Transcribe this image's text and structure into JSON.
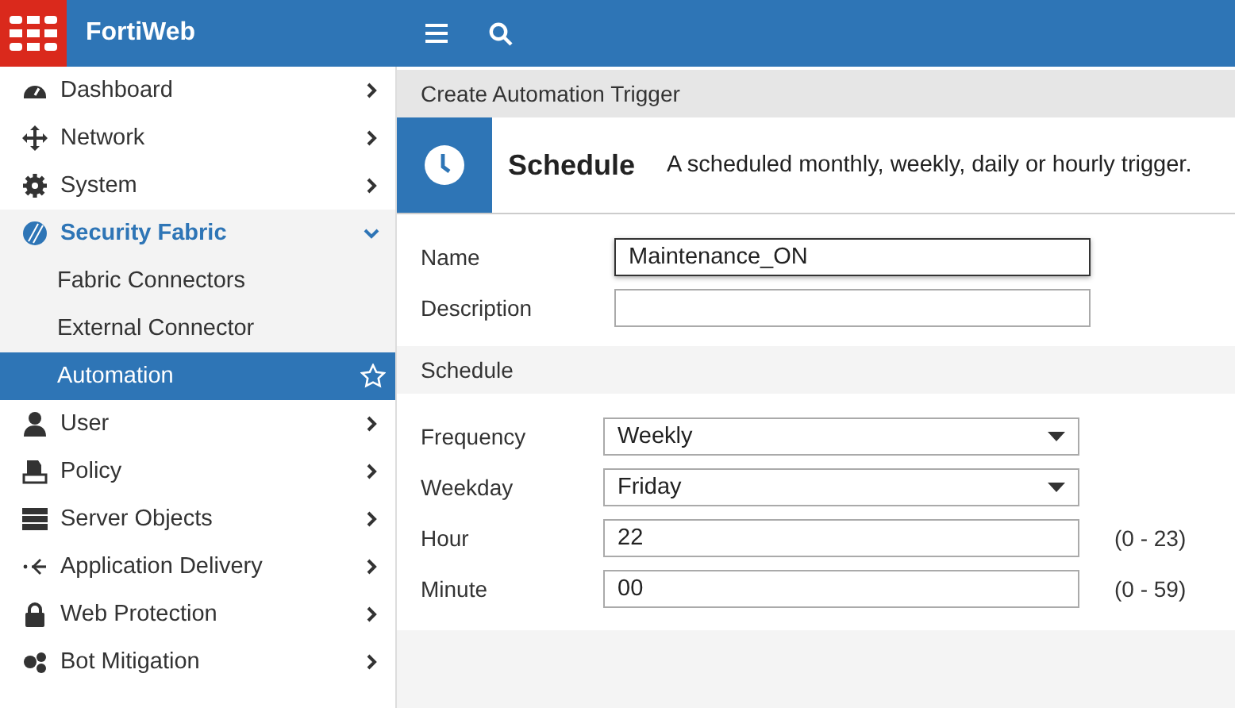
{
  "header": {
    "brand": "FortiWeb"
  },
  "sidebar": {
    "items": [
      {
        "label": "Dashboard",
        "expanded": false
      },
      {
        "label": "Network",
        "expanded": false
      },
      {
        "label": "System",
        "expanded": false
      },
      {
        "label": "Security Fabric",
        "expanded": true,
        "children": [
          {
            "label": "Fabric Connectors",
            "selected": false
          },
          {
            "label": "External Connector",
            "selected": false
          },
          {
            "label": "Automation",
            "selected": true
          }
        ]
      },
      {
        "label": "User",
        "expanded": false
      },
      {
        "label": "Policy",
        "expanded": false
      },
      {
        "label": "Server Objects",
        "expanded": false
      },
      {
        "label": "Application Delivery",
        "expanded": false
      },
      {
        "label": "Web Protection",
        "expanded": false
      },
      {
        "label": "Bot Mitigation",
        "expanded": false
      }
    ]
  },
  "page": {
    "breadcrumb": "Create Automation Trigger",
    "trigger": {
      "title": "Schedule",
      "description": "A scheduled monthly, weekly, daily or hourly trigger."
    },
    "fields": [
      {
        "label": "Name",
        "kind": "text",
        "value": "Maintenance_ON",
        "focused": true
      },
      {
        "label": "Description",
        "kind": "text",
        "focused": false
      }
    ],
    "section_title": "Schedule",
    "schedule_fields": [
      {
        "label": "Frequency",
        "kind": "select",
        "value": "Weekly"
      },
      {
        "label": "Weekday",
        "kind": "select",
        "value": "Friday"
      },
      {
        "label": "Hour",
        "kind": "text",
        "value": "22",
        "hint": "(0 - 23)"
      },
      {
        "label": "Minute",
        "kind": "text",
        "value": "00",
        "hint": "(0 - 59)"
      }
    ]
  }
}
